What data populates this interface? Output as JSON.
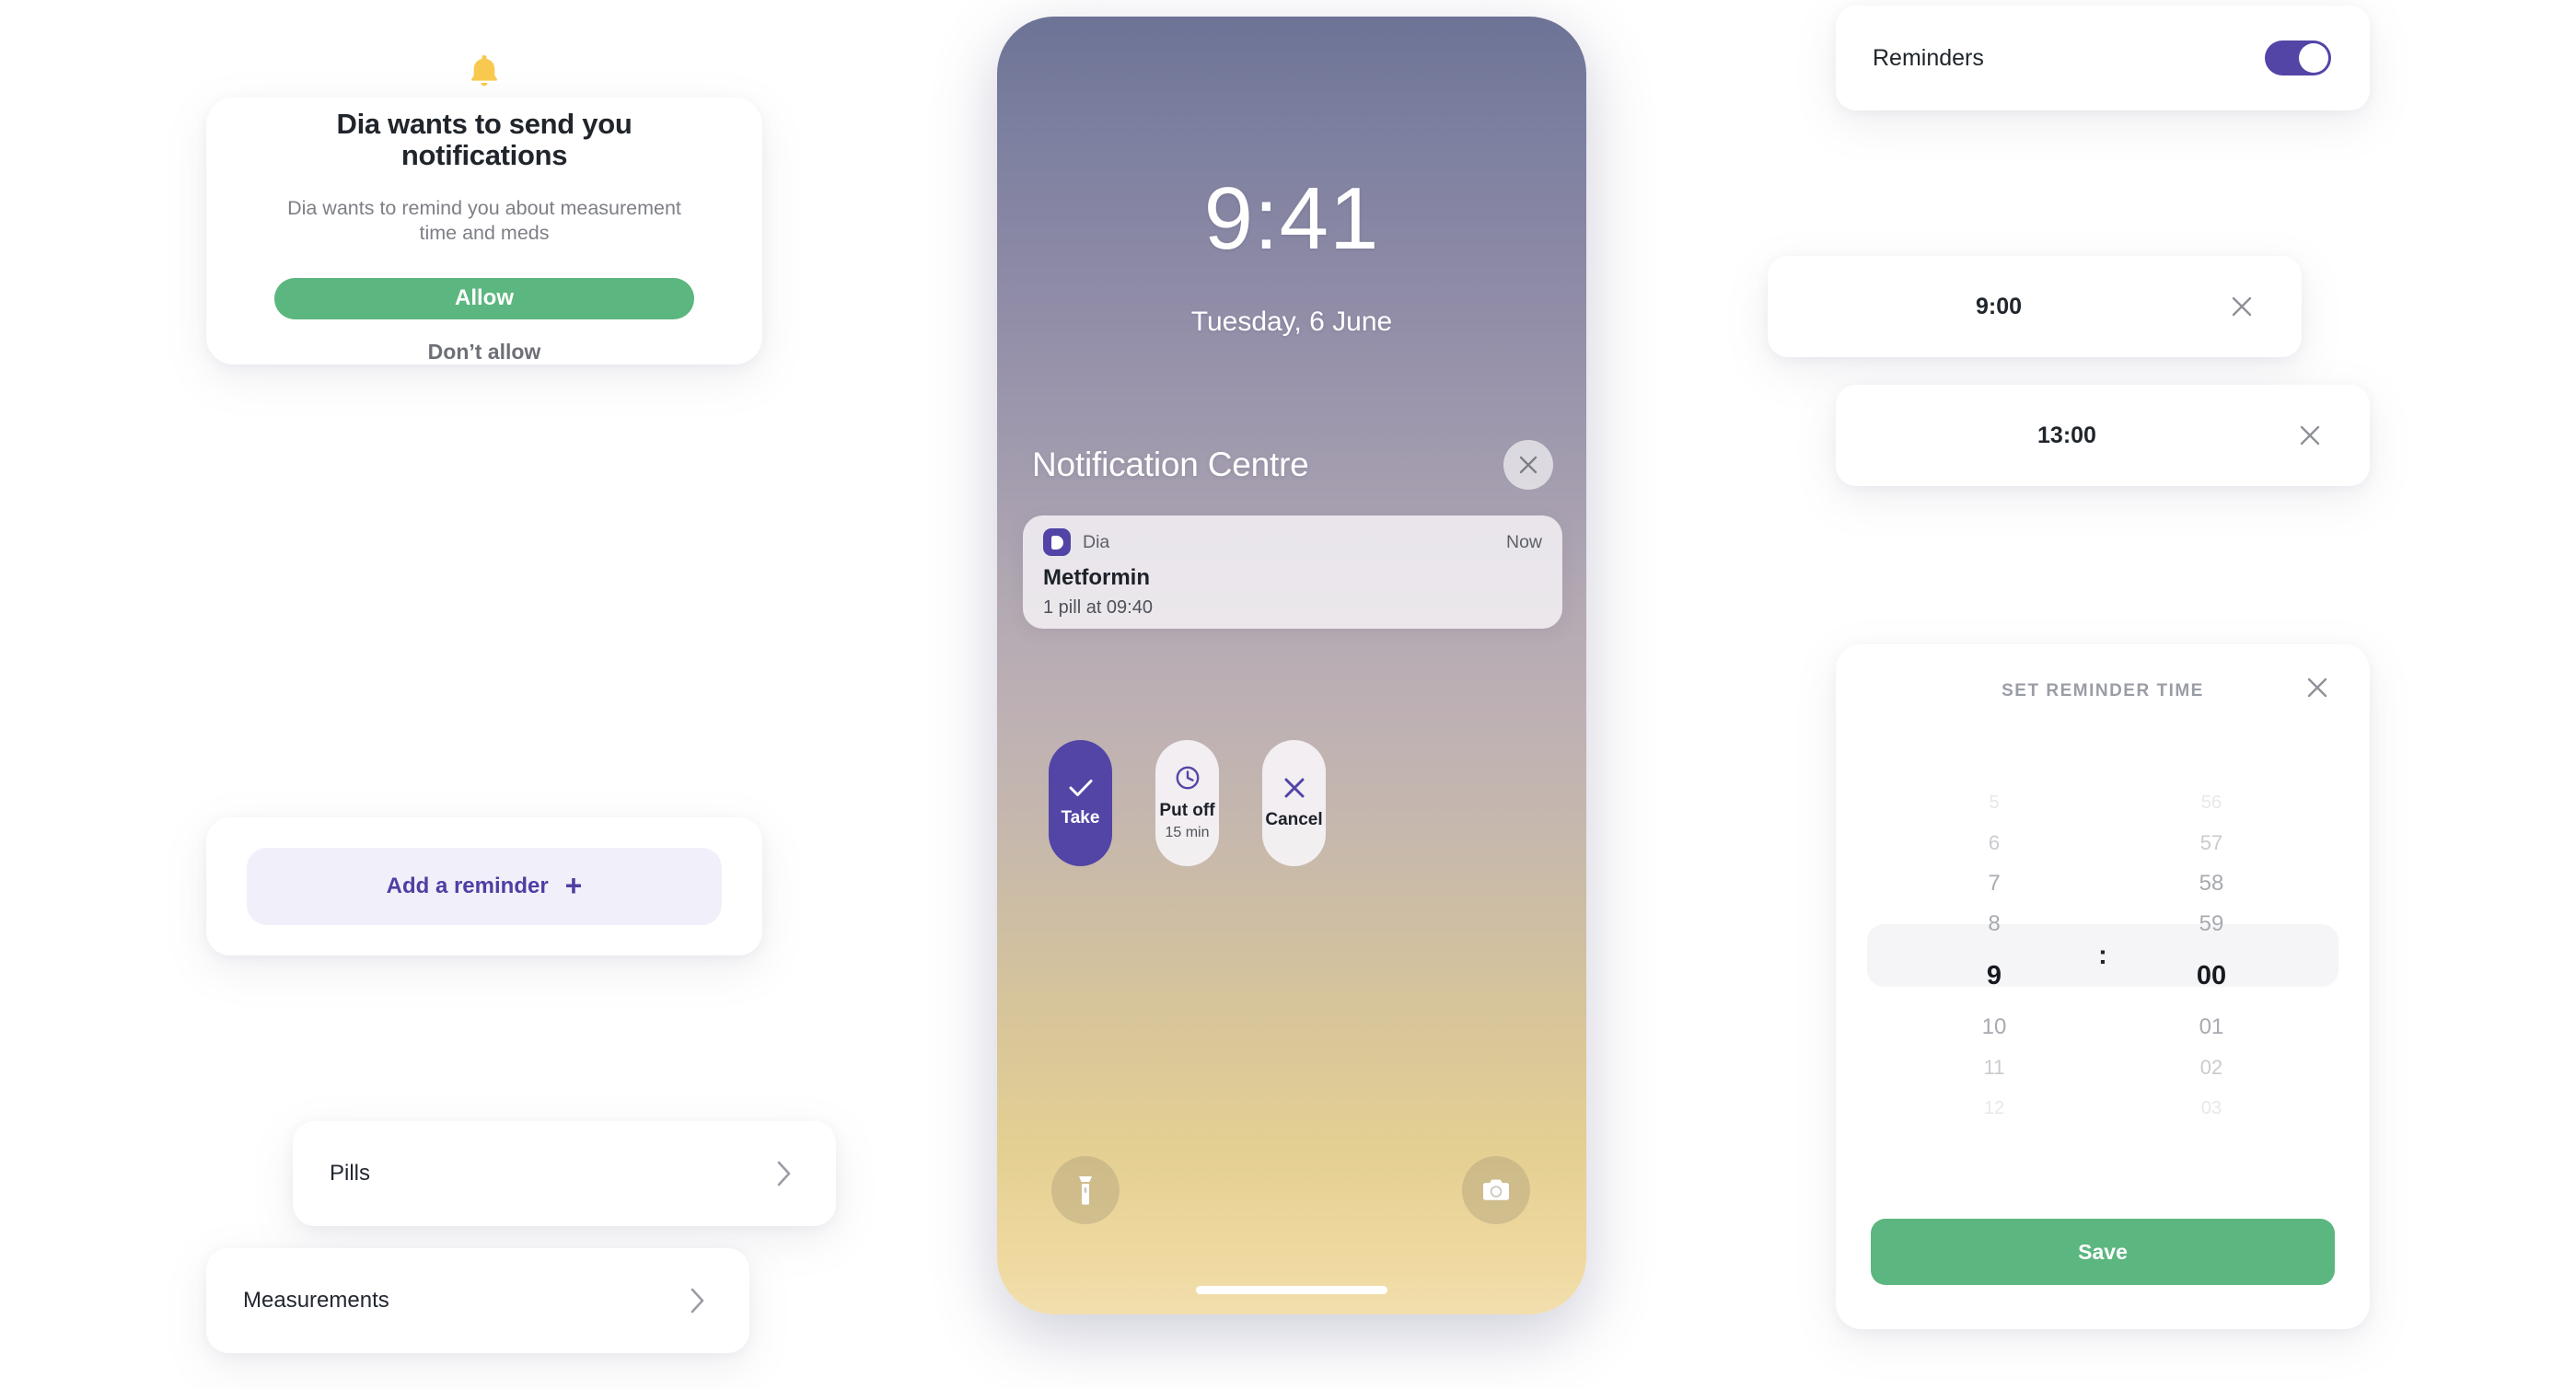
{
  "permission_dialog": {
    "icon": "bell-icon",
    "title": "Dia wants to send you notifications",
    "subtitle": "Dia wants to remind you about measurement time and meds",
    "allow_label": "Allow",
    "deny_label": "Don’t allow",
    "allow_color": "#5cb67f"
  },
  "add_reminder": {
    "label": "Add a reminder",
    "plus": "+",
    "text_color": "#4e3fa3",
    "bg_color": "#f1f0fa"
  },
  "nav_rows": [
    {
      "label": "Pills",
      "chevron": "chevron-right-icon"
    },
    {
      "label": "Measurements",
      "chevron": "chevron-right-icon"
    }
  ],
  "phone": {
    "lock_time": "9:41",
    "lock_date": "Tuesday, 6 June",
    "notification_centre_title": "Notification Centre",
    "close_icon": "close-icon",
    "notification": {
      "app_icon": "dia-app-icon",
      "app_name": "Dia",
      "time": "Now",
      "title": "Metformin",
      "body": "1 pill at 09:40"
    },
    "actions": [
      {
        "icon": "check-icon",
        "label": "Take",
        "sub": ""
      },
      {
        "icon": "clock-icon",
        "label": "Put off",
        "sub": "15 min"
      },
      {
        "icon": "close-icon",
        "label": "Cancel",
        "sub": ""
      }
    ],
    "quick_actions": [
      {
        "icon": "flashlight-icon"
      },
      {
        "icon": "camera-icon"
      }
    ]
  },
  "reminders_panel": {
    "toggle_label": "Reminders",
    "toggle_on": true,
    "toggle_color": "#5245a6",
    "times": [
      {
        "value": "9:00",
        "remove_icon": "close-icon"
      },
      {
        "value": "13:00",
        "remove_icon": "close-icon"
      }
    ]
  },
  "time_picker": {
    "title": "SET REMINDER TIME",
    "close_icon": "close-icon",
    "hours": [
      "5",
      "6",
      "7",
      "8",
      "9",
      "10",
      "11",
      "12"
    ],
    "minutes": [
      "56",
      "57",
      "58",
      "59",
      "00",
      "01",
      "02",
      "03"
    ],
    "selected_hour": "9",
    "selected_minute": "00",
    "separator": ":",
    "save_label": "Save",
    "save_color": "#5cb67f"
  }
}
